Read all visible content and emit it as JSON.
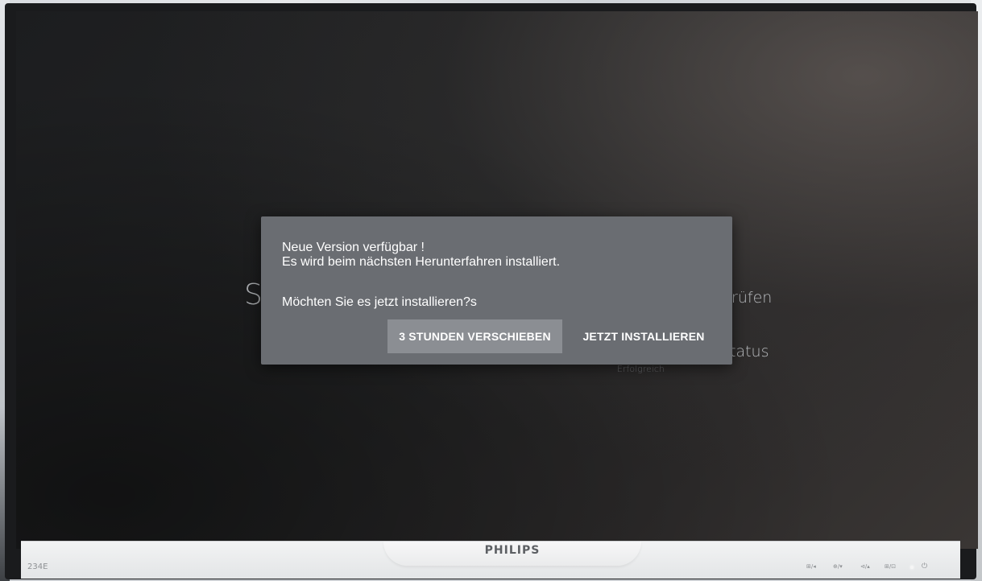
{
  "background": {
    "title_fragment": "S",
    "item_check_fragment": "prüfen",
    "item_status_fragment": "tatus",
    "item_status_value": "Erfolgreich"
  },
  "dialog": {
    "line1": "Neue Version verfügbar !",
    "line2": "Es wird beim nächsten Herunterfahren installiert.",
    "question": "Möchten Sie es jetzt installieren?s",
    "buttons": {
      "postpone": "3 STUNDEN VERSCHIEBEN",
      "install": "JETZT INSTALLIEREN"
    }
  },
  "monitor": {
    "brand": "PHILIPS",
    "model": "234E",
    "controls": [
      "⊞/◂",
      "⊕/▾",
      "⊲/▴",
      "⊞/⊡"
    ],
    "power_icon": "power-icon"
  },
  "colors": {
    "dialog_bg": "#6a6d72",
    "button_focus_bg": "#8b8e93",
    "screen_bg": "#242526"
  }
}
